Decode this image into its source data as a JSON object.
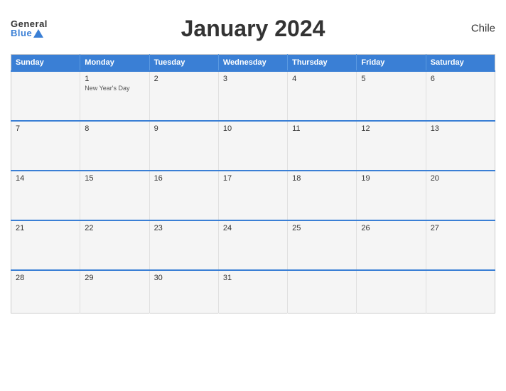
{
  "header": {
    "title": "January 2024",
    "country": "Chile",
    "logo_general": "General",
    "logo_blue": "Blue"
  },
  "weekdays": [
    "Sunday",
    "Monday",
    "Tuesday",
    "Wednesday",
    "Thursday",
    "Friday",
    "Saturday"
  ],
  "weeks": [
    [
      {
        "day": "",
        "holiday": ""
      },
      {
        "day": "1",
        "holiday": "New Year's Day"
      },
      {
        "day": "2",
        "holiday": ""
      },
      {
        "day": "3",
        "holiday": ""
      },
      {
        "day": "4",
        "holiday": ""
      },
      {
        "day": "5",
        "holiday": ""
      },
      {
        "day": "6",
        "holiday": ""
      }
    ],
    [
      {
        "day": "7",
        "holiday": ""
      },
      {
        "day": "8",
        "holiday": ""
      },
      {
        "day": "9",
        "holiday": ""
      },
      {
        "day": "10",
        "holiday": ""
      },
      {
        "day": "11",
        "holiday": ""
      },
      {
        "day": "12",
        "holiday": ""
      },
      {
        "day": "13",
        "holiday": ""
      }
    ],
    [
      {
        "day": "14",
        "holiday": ""
      },
      {
        "day": "15",
        "holiday": ""
      },
      {
        "day": "16",
        "holiday": ""
      },
      {
        "day": "17",
        "holiday": ""
      },
      {
        "day": "18",
        "holiday": ""
      },
      {
        "day": "19",
        "holiday": ""
      },
      {
        "day": "20",
        "holiday": ""
      }
    ],
    [
      {
        "day": "21",
        "holiday": ""
      },
      {
        "day": "22",
        "holiday": ""
      },
      {
        "day": "23",
        "holiday": ""
      },
      {
        "day": "24",
        "holiday": ""
      },
      {
        "day": "25",
        "holiday": ""
      },
      {
        "day": "26",
        "holiday": ""
      },
      {
        "day": "27",
        "holiday": ""
      }
    ],
    [
      {
        "day": "28",
        "holiday": ""
      },
      {
        "day": "29",
        "holiday": ""
      },
      {
        "day": "30",
        "holiday": ""
      },
      {
        "day": "31",
        "holiday": ""
      },
      {
        "day": "",
        "holiday": ""
      },
      {
        "day": "",
        "holiday": ""
      },
      {
        "day": "",
        "holiday": ""
      }
    ]
  ],
  "colors": {
    "header_bg": "#3a7fd5",
    "calendar_border": "#3a7fd5",
    "cell_bg": "#f5f5f5"
  }
}
